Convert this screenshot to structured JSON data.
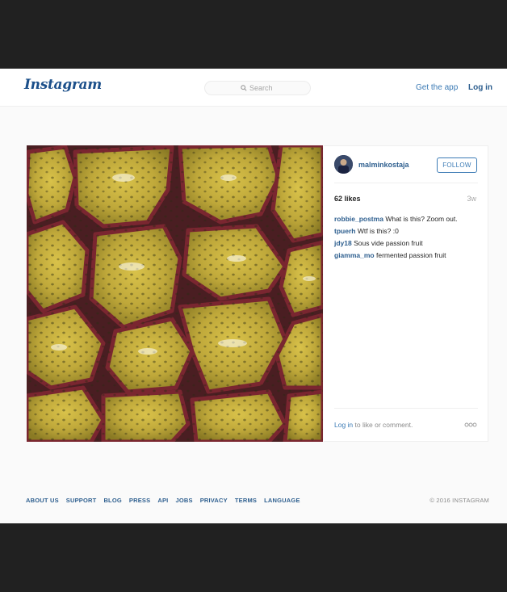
{
  "header": {
    "logo_text": "Instagram",
    "search_placeholder": "Search",
    "get_app_label": "Get the app",
    "login_label": "Log in"
  },
  "post": {
    "username": "malminkostaja",
    "follow_label": "FOLLOW",
    "likes": "62 likes",
    "age": "3w",
    "comments": [
      {
        "user": "robbie_postma",
        "text": "What is this? Zoom out."
      },
      {
        "user": "tpuerh",
        "text": "Wtf is this? :0"
      },
      {
        "user": "jdy18",
        "text": "Sous vide passion fruit"
      },
      {
        "user": "giamma_mo",
        "text": "fermented passion fruit"
      }
    ],
    "login_link": "Log in",
    "login_suffix": "to like or comment."
  },
  "footer": {
    "links": [
      "ABOUT US",
      "SUPPORT",
      "BLOG",
      "PRESS",
      "API",
      "JOBS",
      "PRIVACY",
      "TERMS",
      "LANGUAGE"
    ],
    "copyright": "© 2016 INSTAGRAM"
  },
  "colors": {
    "link_blue": "#3c7bb5",
    "dark_blue": "#2e5f8f",
    "page_bg": "#fafafa",
    "letterbox": "#212121"
  }
}
